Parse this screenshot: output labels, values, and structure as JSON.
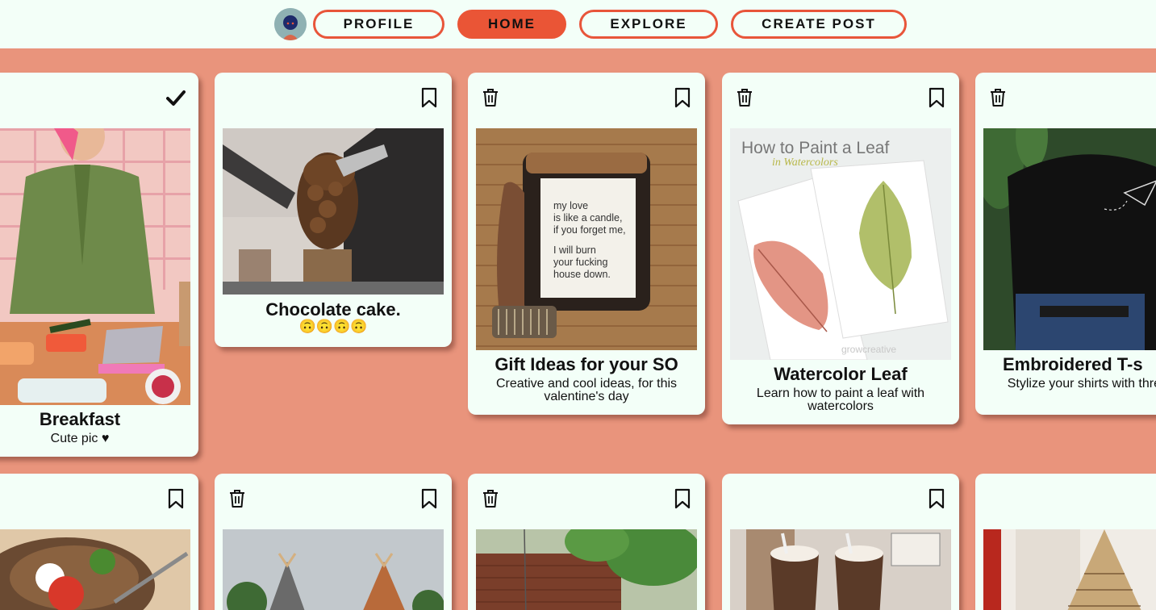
{
  "nav": {
    "profile": "PROFILE",
    "home": "HOME",
    "explore": "EXPLORE",
    "create_post": "CREATE POST"
  },
  "posts": [
    {
      "title": "Breakfast",
      "description": "Cute pic ♥",
      "icons": [
        "check-icon"
      ]
    },
    {
      "title": "Chocolate cake.",
      "description": "🙃🙃🙃🙃",
      "icons": [
        "bookmark-icon"
      ]
    },
    {
      "title": "Gift Ideas for your SO",
      "description": "Creative and cool ideas, for this valentine's day",
      "icons": [
        "trash-icon",
        "bookmark-icon"
      ]
    },
    {
      "title": "Watercolor Leaf",
      "description": "Learn how to paint a leaf with watercolors",
      "icons": [
        "trash-icon",
        "bookmark-icon"
      ]
    },
    {
      "title": "Embroidered T-s",
      "description": "Stylize your shirts with thread hoop!",
      "icons": [
        "trash-icon"
      ]
    },
    {
      "title": "",
      "description": "",
      "icons": [
        "bookmark-icon"
      ]
    },
    {
      "title": "",
      "description": "",
      "icons": [
        "trash-icon",
        "bookmark-icon"
      ]
    },
    {
      "title": "",
      "description": "",
      "icons": [
        "trash-icon",
        "bookmark-icon"
      ]
    },
    {
      "title": "",
      "description": "",
      "icons": [
        "bookmark-icon"
      ]
    },
    {
      "title": "",
      "description": "",
      "icons": []
    }
  ],
  "image_text": {
    "candle_label": [
      "my love",
      "is like a candle,",
      "if you forget me,",
      "",
      "I will burn",
      "your fucking",
      "house down."
    ],
    "leaf_heading": "How to Paint a Leaf",
    "leaf_subheading": "in Watercolors",
    "leaf_watermark": "growcreative"
  },
  "colors": {
    "background": "#e9947c",
    "card": "#f3fff8",
    "accent": "#ea5536"
  }
}
